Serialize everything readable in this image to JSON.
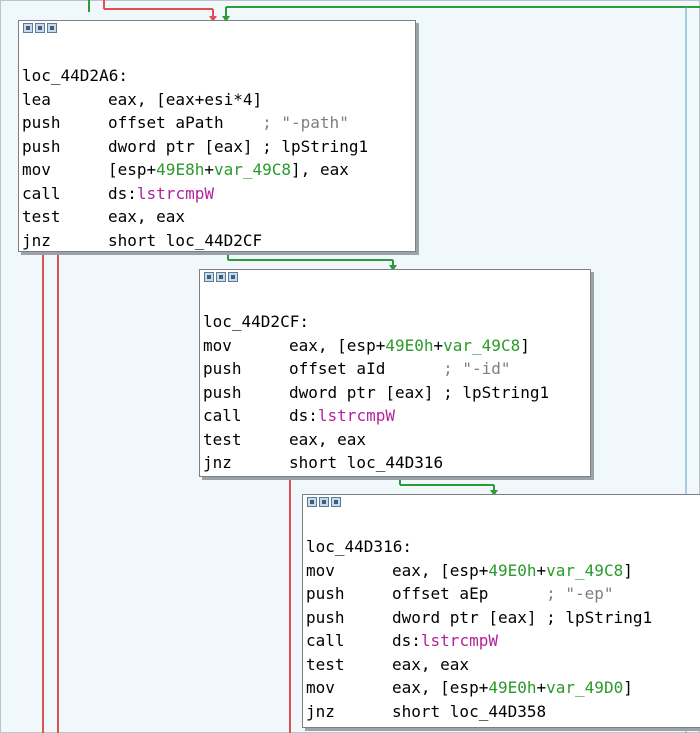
{
  "colors": {
    "background": "#f1f8fc",
    "edge_true": "#2e9b3a",
    "edge_false": "#e05050",
    "comment": "#7f7f7f",
    "number": "#2a9a2a",
    "api": "#b3239b"
  },
  "nodes": [
    {
      "label": "loc_44D2A6:",
      "lines": [
        {
          "mnemonic": "lea",
          "ops": [
            {
              "t": "eax, [eax+esi*4]",
              "c": ""
            }
          ]
        },
        {
          "mnemonic": "push",
          "ops": [
            {
              "t": "offset aPath    ",
              "c": ""
            },
            {
              "t": "; \"-path\"",
              "c": "cm"
            }
          ]
        },
        {
          "mnemonic": "push",
          "ops": [
            {
              "t": "dword ptr [eax] ; lpString1",
              "c": ""
            }
          ]
        },
        {
          "mnemonic": "mov",
          "ops": [
            {
              "t": "[esp+",
              "c": ""
            },
            {
              "t": "49E8h",
              "c": "num"
            },
            {
              "t": "+",
              "c": ""
            },
            {
              "t": "var_49C8",
              "c": "var"
            },
            {
              "t": "], eax",
              "c": ""
            }
          ]
        },
        {
          "mnemonic": "call",
          "ops": [
            {
              "t": "ds:",
              "c": ""
            },
            {
              "t": "lstrcmpW",
              "c": "api"
            }
          ]
        },
        {
          "mnemonic": "test",
          "ops": [
            {
              "t": "eax, eax",
              "c": ""
            }
          ]
        },
        {
          "mnemonic": "jnz",
          "ops": [
            {
              "t": "short loc_44D2CF",
              "c": ""
            }
          ]
        }
      ]
    },
    {
      "label": "loc_44D2CF:",
      "lines": [
        {
          "mnemonic": "mov",
          "ops": [
            {
              "t": "eax, [esp+",
              "c": ""
            },
            {
              "t": "49E0h",
              "c": "num"
            },
            {
              "t": "+",
              "c": ""
            },
            {
              "t": "var_49C8",
              "c": "var"
            },
            {
              "t": "]",
              "c": ""
            }
          ]
        },
        {
          "mnemonic": "push",
          "ops": [
            {
              "t": "offset aId      ",
              "c": ""
            },
            {
              "t": "; \"-id\"",
              "c": "cm"
            }
          ]
        },
        {
          "mnemonic": "push",
          "ops": [
            {
              "t": "dword ptr [eax] ; lpString1",
              "c": ""
            }
          ]
        },
        {
          "mnemonic": "call",
          "ops": [
            {
              "t": "ds:",
              "c": ""
            },
            {
              "t": "lstrcmpW",
              "c": "api"
            }
          ]
        },
        {
          "mnemonic": "test",
          "ops": [
            {
              "t": "eax, eax",
              "c": ""
            }
          ]
        },
        {
          "mnemonic": "jnz",
          "ops": [
            {
              "t": "short loc_44D316",
              "c": ""
            }
          ]
        }
      ]
    },
    {
      "label": "loc_44D316:",
      "lines": [
        {
          "mnemonic": "mov",
          "ops": [
            {
              "t": "eax, [esp+",
              "c": ""
            },
            {
              "t": "49E0h",
              "c": "num"
            },
            {
              "t": "+",
              "c": ""
            },
            {
              "t": "var_49C8",
              "c": "var"
            },
            {
              "t": "]",
              "c": ""
            }
          ]
        },
        {
          "mnemonic": "push",
          "ops": [
            {
              "t": "offset aEp      ",
              "c": ""
            },
            {
              "t": "; \"-ep\"",
              "c": "cm"
            }
          ]
        },
        {
          "mnemonic": "push",
          "ops": [
            {
              "t": "dword ptr [eax] ; lpString1",
              "c": ""
            }
          ]
        },
        {
          "mnemonic": "call",
          "ops": [
            {
              "t": "ds:",
              "c": ""
            },
            {
              "t": "lstrcmpW",
              "c": "api"
            }
          ]
        },
        {
          "mnemonic": "test",
          "ops": [
            {
              "t": "eax, eax",
              "c": ""
            }
          ]
        },
        {
          "mnemonic": "mov",
          "ops": [
            {
              "t": "eax, [esp+",
              "c": ""
            },
            {
              "t": "49E0h",
              "c": "num"
            },
            {
              "t": "+",
              "c": ""
            },
            {
              "t": "var_49D0",
              "c": "var"
            },
            {
              "t": "]",
              "c": ""
            }
          ]
        },
        {
          "mnemonic": "jnz",
          "ops": [
            {
              "t": "short loc_44D358",
              "c": ""
            }
          ]
        }
      ]
    }
  ]
}
